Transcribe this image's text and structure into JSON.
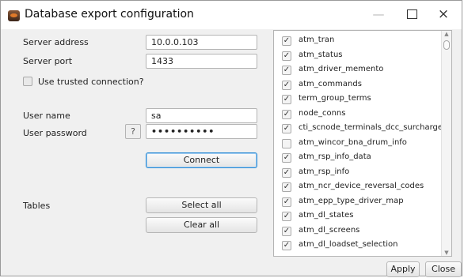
{
  "window": {
    "title": "Database export configuration",
    "minimize": "—",
    "close": "×"
  },
  "form": {
    "server_address_label": "Server address",
    "server_address_value": "10.0.0.103",
    "server_port_label": "Server port",
    "server_port_value": "1433",
    "trusted_connection_label": "Use trusted connection?",
    "user_name_label": "User name",
    "user_name_value": "sa",
    "user_password_label": "User password",
    "password_help": "?",
    "user_password_value": "••••••••••",
    "connect_label": "Connect",
    "tables_label": "Tables",
    "select_all_label": "Select all",
    "clear_all_label": "Clear all"
  },
  "tables": [
    {
      "name": "atm_tran",
      "checked": true
    },
    {
      "name": "atm_status",
      "checked": true
    },
    {
      "name": "atm_driver_memento",
      "checked": true
    },
    {
      "name": "atm_commands",
      "checked": true
    },
    {
      "name": "term_group_terms",
      "checked": true
    },
    {
      "name": "node_conns",
      "checked": true
    },
    {
      "name": "cti_scnode_terminals_dcc_surcharge",
      "checked": true
    },
    {
      "name": "atm_wincor_bna_drum_info",
      "checked": false
    },
    {
      "name": "atm_rsp_info_data",
      "checked": true
    },
    {
      "name": "atm_rsp_info",
      "checked": true
    },
    {
      "name": "atm_ncr_device_reversal_codes",
      "checked": true
    },
    {
      "name": "atm_epp_type_driver_map",
      "checked": true
    },
    {
      "name": "atm_dl_states",
      "checked": true
    },
    {
      "name": "atm_dl_screens",
      "checked": true
    },
    {
      "name": "atm_dl_loadset_selection",
      "checked": true
    }
  ],
  "check_glyph": "✓",
  "footer": {
    "apply_label": "Apply",
    "close_label": "Close"
  }
}
